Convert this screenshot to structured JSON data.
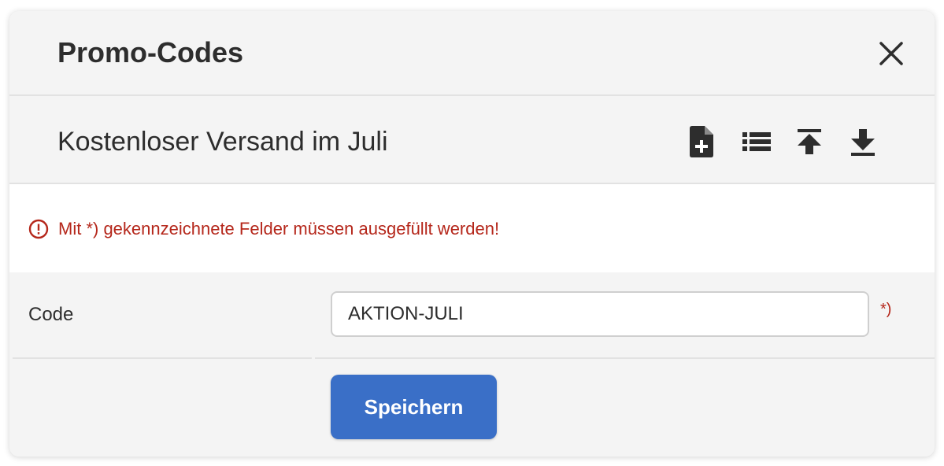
{
  "header": {
    "title": "Promo-Codes",
    "close_icon": "close-icon"
  },
  "subheader": {
    "title": "Kostenloser Versand im Juli",
    "tools": [
      {
        "icon": "file-add-icon"
      },
      {
        "icon": "list-icon"
      },
      {
        "icon": "upload-icon"
      },
      {
        "icon": "download-icon"
      }
    ]
  },
  "notice": {
    "icon": "exclamation-circle-icon",
    "text": "Mit *) gekennzeichnete Felder müssen ausgefüllt werden!"
  },
  "form": {
    "code_label": "Code",
    "code_value": "AKTION-JULI",
    "required_mark": "*)",
    "save_label": "Speichern"
  },
  "colors": {
    "accent": "#3a6fc7",
    "error": "#b5271b",
    "panel": "#f4f4f4"
  }
}
